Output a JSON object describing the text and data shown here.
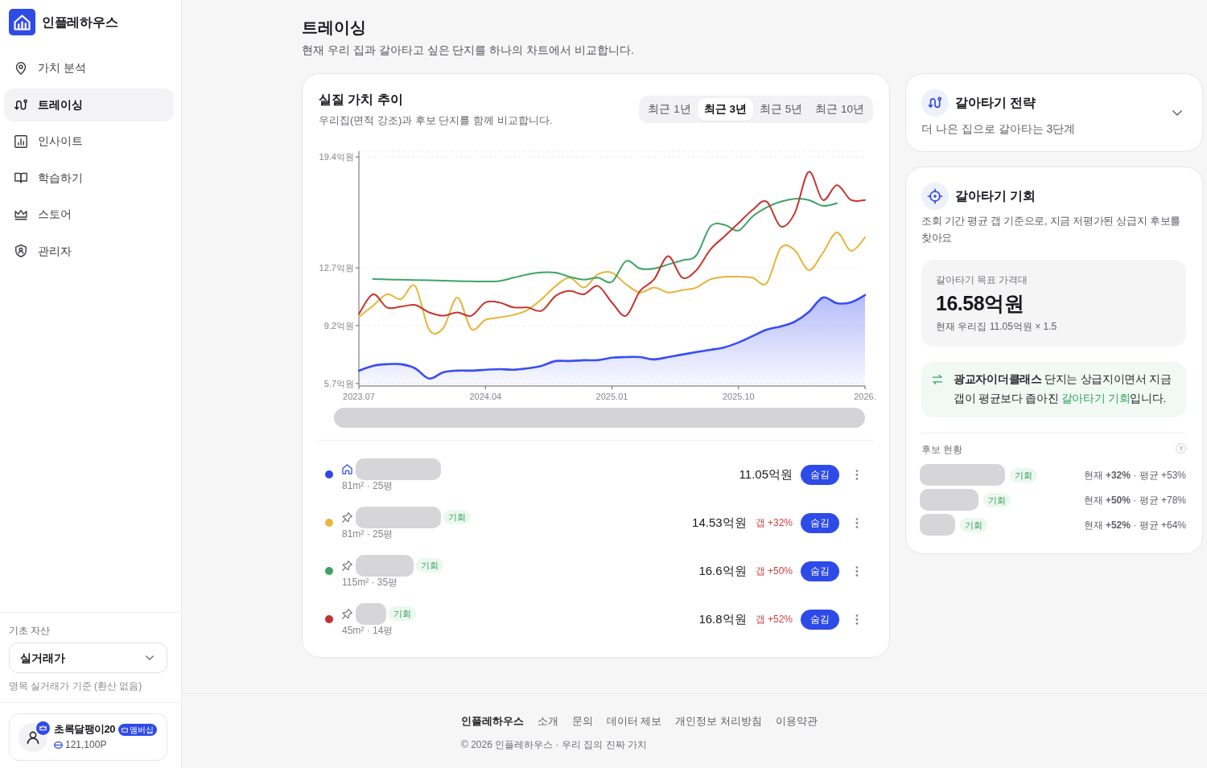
{
  "sidebar": {
    "brand": "인플레하우스",
    "items": [
      {
        "label": "가치 분석",
        "selected": false
      },
      {
        "label": "트레이싱",
        "selected": true
      },
      {
        "label": "인사이트",
        "selected": false
      },
      {
        "label": "학습하기",
        "selected": false
      },
      {
        "label": "스토어",
        "selected": false
      },
      {
        "label": "관리자",
        "selected": false
      }
    ],
    "asset": {
      "label": "기초 자산",
      "value": "실거래가",
      "hint": "명목 실거래가 기준 (환산 없음)"
    },
    "user": {
      "name": "초록달팽이20",
      "badge": "멤버십",
      "points": "121,100P"
    }
  },
  "header": {
    "title": "트레이싱",
    "subtitle": "현재 우리 집과 갈아타고 싶은 단지를 하나의 차트에서 비교합니다."
  },
  "chart_card": {
    "title": "실질 가치 추이",
    "subtitle": "우리집(면적 강조)과 후보 단지를 함께 비교합니다.",
    "tabs": [
      {
        "label": "최근 1년",
        "selected": false
      },
      {
        "label": "최근 3년",
        "selected": true
      },
      {
        "label": "최근 5년",
        "selected": false
      },
      {
        "label": "최근 10년",
        "selected": false
      }
    ],
    "chart_data": {
      "type": "line",
      "grid": true,
      "categories": [
        "2023.07",
        null,
        null,
        null,
        null,
        null,
        null,
        null,
        null,
        "2024.04",
        null,
        null,
        null,
        null,
        null,
        null,
        null,
        null,
        "2025.01",
        null,
        null,
        null,
        null,
        null,
        null,
        null,
        null,
        "2025.10",
        null,
        null,
        null,
        null,
        null,
        null,
        null,
        null,
        "2026."
      ],
      "ylim": [
        5.55,
        19.75
      ],
      "yticks": [
        {
          "value": 5.7,
          "label": "5.7억원"
        },
        {
          "value": 9.2,
          "label": "9.2억원"
        },
        {
          "value": 12.7,
          "label": "12.7억원"
        },
        {
          "value": 19.4,
          "label": "19.4억원"
        }
      ],
      "series": [
        {
          "color": "#3a4ef0",
          "values": [
            6.48,
            6.77,
            6.87,
            6.87,
            6.62,
            6.0,
            6.38,
            6.48,
            6.48,
            6.53,
            6.57,
            6.53,
            6.62,
            6.77,
            7.06,
            7.06,
            7.11,
            7.11,
            7.26,
            7.3,
            7.3,
            7.16,
            7.3,
            7.45,
            7.6,
            7.74,
            7.89,
            8.18,
            8.57,
            8.96,
            9.15,
            9.44,
            10.02,
            10.9,
            10.56,
            10.61,
            11.05
          ]
        },
        {
          "color": "#e8b33a",
          "values": [
            9.73,
            10.4,
            11.1,
            10.8,
            11.6,
            8.95,
            9.05,
            10.9,
            9.0,
            9.55,
            9.7,
            9.85,
            10.15,
            10.8,
            11.6,
            12.1,
            11.5,
            12.3,
            12.4,
            11.7,
            11.2,
            11.5,
            11.2,
            11.35,
            11.5,
            12.0,
            12.15,
            12.16,
            12.1,
            11.77,
            13.9,
            13.77,
            12.55,
            13.6,
            14.84,
            13.72,
            14.53
          ]
        },
        {
          "color": "#3fa463",
          "values": [
            null,
            12.02,
            12.0,
            11.98,
            11.96,
            11.94,
            11.92,
            11.9,
            11.88,
            11.87,
            11.9,
            12.1,
            12.3,
            12.42,
            12.4,
            12.15,
            11.98,
            12.1,
            11.85,
            13.1,
            12.65,
            12.65,
            12.9,
            13.15,
            13.45,
            15.2,
            15.3,
            14.95,
            15.8,
            16.35,
            16.7,
            16.87,
            16.8,
            16.45,
            16.6,
            null,
            null
          ]
        },
        {
          "color": "#c8332f",
          "values": [
            9.9,
            11.1,
            10.3,
            10.35,
            10.45,
            10.0,
            9.8,
            10.0,
            9.8,
            10.6,
            10.6,
            10.3,
            10.3,
            10.1,
            11.0,
            11.3,
            11.1,
            11.6,
            10.6,
            9.8,
            11.3,
            12.0,
            13.4,
            12.1,
            12.55,
            13.8,
            14.6,
            15.4,
            16.2,
            16.7,
            15.2,
            16.0,
            18.5,
            16.8,
            17.7,
            16.8,
            16.8
          ]
        }
      ]
    },
    "rows": [
      {
        "kind": "home",
        "color": "#2f49e6",
        "size": "81m² · 25평",
        "price": "11.05억원",
        "button": "숨김"
      },
      {
        "kind": "candidate",
        "color": "#eab53b",
        "badge": "기회",
        "size": "81m² · 25평",
        "price": "14.53억원",
        "gap": "갭 +32%",
        "button": "숨김"
      },
      {
        "kind": "candidate",
        "color": "#3aa360",
        "badge": "기회",
        "size": "115m² · 35평",
        "price": "16.6억원",
        "gap": "갭 +50%",
        "button": "숨김"
      },
      {
        "kind": "candidate",
        "color": "#c4302e",
        "badge": "기회",
        "size": "45m² · 14평",
        "price": "16.8억원",
        "gap": "갭 +52%",
        "button": "숨김"
      }
    ]
  },
  "strategy_card": {
    "title": "갈아타기 전략",
    "subtitle": "더 나은 집으로 갈아타는 3단계",
    "expanded": false
  },
  "opportunity_card": {
    "title": "갈아타기 기회",
    "description": "조회 기간 평균 갭 기준으로, 지금 저평가된 상급지 후보를 찾아요",
    "target": {
      "label": "갈아타기 목표 가격대",
      "value": "16.58억원",
      "note": "현재 우리집 11.05억원 × 1.5"
    },
    "callout": [
      {
        "kind": "strong",
        "text": "광교자이더클래스"
      },
      {
        "kind": "plain",
        "text": " 단지는 상급지이면서 지금 갭이 평균보다 좁아진 "
      },
      {
        "kind": "accent",
        "text": "갈아타기 기회"
      },
      {
        "kind": "plain",
        "text": "입니다."
      }
    ],
    "status": {
      "title": "후보 현황",
      "help": "?",
      "rows": [
        {
          "badge": "기회",
          "text": "현재 **+32%** · 평균 +53%"
        },
        {
          "badge": "기회",
          "text": "현재 **+50%** · 평균 +78%"
        },
        {
          "badge": "기회",
          "text": "현재 **+52%** · 평균 +64%"
        }
      ]
    }
  },
  "footer": {
    "links": [
      {
        "label": "인플레하우스",
        "kind": "brand"
      },
      {
        "label": "소개",
        "kind": "link"
      },
      {
        "label": "문의",
        "kind": "link"
      },
      {
        "label": "데이터 제보",
        "kind": "link"
      },
      {
        "label": "개인정보 처리방침",
        "kind": "link"
      },
      {
        "label": "이용약관",
        "kind": "link"
      }
    ],
    "copyright": "© 2026 인플레하우스 · 우리 집의 진짜 가치"
  }
}
